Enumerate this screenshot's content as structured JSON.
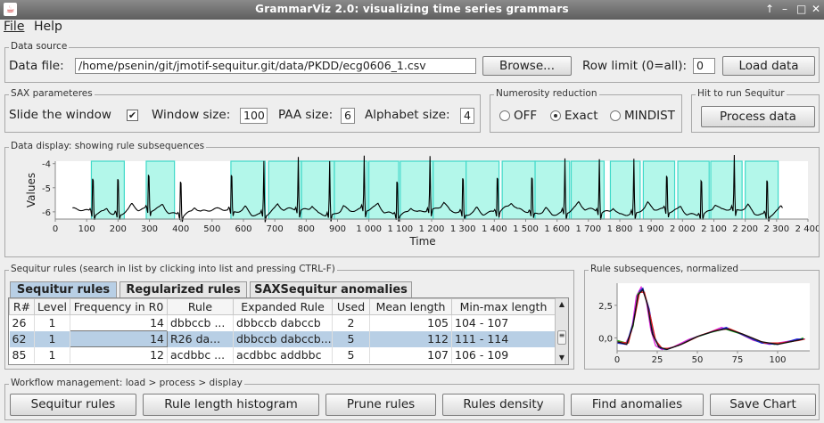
{
  "window": {
    "title": "GrammarViz 2.0: visualizing time series grammars",
    "controls": [
      "↑",
      "–",
      "□",
      "✕"
    ]
  },
  "menu": {
    "file": "File",
    "help": "Help"
  },
  "data_source": {
    "legend": "Data source",
    "file_label": "Data file:",
    "file_value": "/home/psenin/git/jmotif-sequitur.git/data/PKDD/ecg0606_1.csv",
    "browse": "Browse...",
    "row_limit_label": "Row limit (0=all):",
    "row_limit_value": "0",
    "load": "Load data"
  },
  "sax": {
    "legend": "SAX parameteres",
    "slide_label": "Slide the window",
    "slide_checked": "✔",
    "window_label": "Window size:",
    "window_value": "100",
    "paa_label": "PAA size:",
    "paa_value": "6",
    "alphabet_label": "Alphabet size:",
    "alphabet_value": "4"
  },
  "numerosity": {
    "legend": "Numerosity reduction",
    "options": [
      "OFF",
      "Exact",
      "MINDIST"
    ],
    "selected": "Exact"
  },
  "run": {
    "legend": "Hit to run Sequitur",
    "button": "Process data"
  },
  "display": {
    "legend": "Data display: showing rule subsequences",
    "ylabel": "Values",
    "xlabel": "Time",
    "highlight_color": "#b3f7ea",
    "edge_color": "#3fd9c9"
  },
  "rules_panel": {
    "legend": "Sequitur rules (search in list by clicking into list and pressing CTRL-F)",
    "tabs": [
      "Sequitur rules",
      "Regularized rules",
      "SAXSequitur anomalies"
    ],
    "columns": [
      "R#",
      "Level",
      "Frequency in R0",
      "Rule",
      "Expanded Rule",
      "Used",
      "Mean length",
      "Min-max length"
    ],
    "rows": [
      [
        "26",
        "1",
        "14",
        "dbbccb ...",
        "dbbccb dabccb",
        "2",
        "105",
        "104 - 107"
      ],
      [
        "62",
        "1",
        "14",
        "R26 da...",
        "dbbccb dabccb...",
        "5",
        "112",
        "111 - 114"
      ],
      [
        "85",
        "1",
        "12",
        "acdbbc ...",
        "acdbbc addbbc",
        "5",
        "107",
        "106 - 109"
      ]
    ],
    "selected_row": 1
  },
  "subseq": {
    "legend": "Rule subsequences, normalized"
  },
  "workflow": {
    "legend": "Workflow management: load > process > display",
    "buttons": [
      "Sequitur rules",
      "Rule length histogram",
      "Prune rules",
      "Rules density",
      "Find anomalies",
      "Save Chart"
    ]
  },
  "chart_data": [
    {
      "type": "line",
      "title": "",
      "xlabel": "Time",
      "ylabel": "Values",
      "xlim": [
        0,
        2400
      ],
      "ylim": [
        -6.3,
        -3.9
      ],
      "x_ticks": [
        "0",
        "100",
        "200",
        "300",
        "400",
        "500",
        "600",
        "700",
        "800",
        "900",
        "1 000",
        "1 100",
        "1 200",
        "1 300",
        "1 400",
        "1 500",
        "1 600",
        "1 700",
        "1 800",
        "1 900",
        "2 000",
        "2 100",
        "2 200",
        "2 300",
        "2 400"
      ],
      "y_ticks": [
        "-4",
        "-5",
        "-6"
      ],
      "beats": [
        120,
        200,
        298,
        400,
        562,
        665,
        775,
        875,
        985,
        1090,
        1195,
        1300,
        1410,
        1520,
        1625,
        1735,
        1845,
        1950,
        2060,
        2165,
        2270
      ],
      "highlighted_intervals": [
        [
          115,
          220
        ],
        [
          290,
          380
        ],
        [
          560,
          670
        ],
        [
          680,
          785
        ],
        [
          785,
          890
        ],
        [
          890,
          995
        ],
        [
          1000,
          1095
        ],
        [
          1100,
          1205
        ],
        [
          1205,
          1310
        ],
        [
          1310,
          1415
        ],
        [
          1425,
          1530
        ],
        [
          1530,
          1640
        ],
        [
          1645,
          1750
        ],
        [
          1770,
          1865
        ],
        [
          1875,
          1975
        ],
        [
          1985,
          2085
        ],
        [
          2090,
          2190
        ],
        [
          2200,
          2305
        ]
      ]
    },
    {
      "type": "line",
      "title": "",
      "xlim": [
        0,
        120
      ],
      "ylim": [
        -1.0,
        4.2
      ],
      "x_ticks": [
        "0",
        "25",
        "50",
        "75",
        "100"
      ],
      "y_ticks": [
        "2,5",
        "0,0"
      ],
      "series": [
        {
          "color": "#e020e0",
          "values": [
            [
              0,
              -0.3
            ],
            [
              5,
              -0.5
            ],
            [
              9,
              0.5
            ],
            [
              12,
              3.2
            ],
            [
              15,
              3.9
            ],
            [
              18,
              3.0
            ],
            [
              21,
              0.6
            ],
            [
              24,
              -0.6
            ],
            [
              28,
              -0.9
            ],
            [
              35,
              -0.7
            ],
            [
              45,
              -0.1
            ],
            [
              55,
              0.3
            ],
            [
              65,
              0.8
            ],
            [
              75,
              0.4
            ],
            [
              85,
              -0.2
            ],
            [
              95,
              -0.5
            ],
            [
              110,
              -0.2
            ],
            [
              115,
              -0.1
            ]
          ]
        },
        {
          "color": "#20c020",
          "values": [
            [
              0,
              -0.2
            ],
            [
              6,
              -0.4
            ],
            [
              10,
              0.9
            ],
            [
              13,
              3.4
            ],
            [
              16,
              3.8
            ],
            [
              19,
              2.6
            ],
            [
              22,
              0.3
            ],
            [
              26,
              -0.7
            ],
            [
              30,
              -0.9
            ],
            [
              38,
              -0.6
            ],
            [
              48,
              0.0
            ],
            [
              58,
              0.4
            ],
            [
              67,
              0.7
            ],
            [
              77,
              0.3
            ],
            [
              88,
              -0.3
            ],
            [
              98,
              -0.5
            ],
            [
              112,
              -0.2
            ],
            [
              116,
              0.0
            ]
          ]
        },
        {
          "color": "#2020e0",
          "values": [
            [
              0,
              -0.4
            ],
            [
              6,
              -0.5
            ],
            [
              10,
              1.2
            ],
            [
              14,
              3.6
            ],
            [
              16,
              3.8
            ],
            [
              20,
              2.2
            ],
            [
              23,
              0.1
            ],
            [
              27,
              -0.8
            ],
            [
              31,
              -0.9
            ],
            [
              40,
              -0.5
            ],
            [
              50,
              0.1
            ],
            [
              60,
              0.5
            ],
            [
              68,
              0.8
            ],
            [
              79,
              0.2
            ],
            [
              90,
              -0.4
            ],
            [
              100,
              -0.5
            ],
            [
              112,
              -0.1
            ],
            [
              117,
              -0.1
            ]
          ]
        },
        {
          "color": "#e02020",
          "values": [
            [
              0,
              -0.3
            ],
            [
              7,
              -0.4
            ],
            [
              11,
              1.6
            ],
            [
              14,
              3.5
            ],
            [
              17,
              3.5
            ],
            [
              21,
              1.5
            ],
            [
              24,
              -0.2
            ],
            [
              28,
              -0.8
            ],
            [
              33,
              -0.8
            ],
            [
              42,
              -0.4
            ],
            [
              52,
              0.2
            ],
            [
              62,
              0.6
            ],
            [
              70,
              0.7
            ],
            [
              80,
              0.2
            ],
            [
              92,
              -0.4
            ],
            [
              102,
              -0.4
            ],
            [
              113,
              -0.2
            ],
            [
              117,
              -0.1
            ]
          ]
        },
        {
          "color": "#111111",
          "values": [
            [
              0,
              -0.3
            ],
            [
              6,
              -0.5
            ],
            [
              10,
              1.0
            ],
            [
              13,
              3.3
            ],
            [
              16,
              3.7
            ],
            [
              19,
              2.5
            ],
            [
              22,
              0.3
            ],
            [
              26,
              -0.7
            ],
            [
              31,
              -0.9
            ],
            [
              40,
              -0.5
            ],
            [
              50,
              0.1
            ],
            [
              60,
              0.5
            ],
            [
              68,
              0.7
            ],
            [
              78,
              0.3
            ],
            [
              90,
              -0.3
            ],
            [
              100,
              -0.5
            ],
            [
              112,
              -0.2
            ],
            [
              116,
              -0.1
            ]
          ]
        }
      ]
    }
  ]
}
